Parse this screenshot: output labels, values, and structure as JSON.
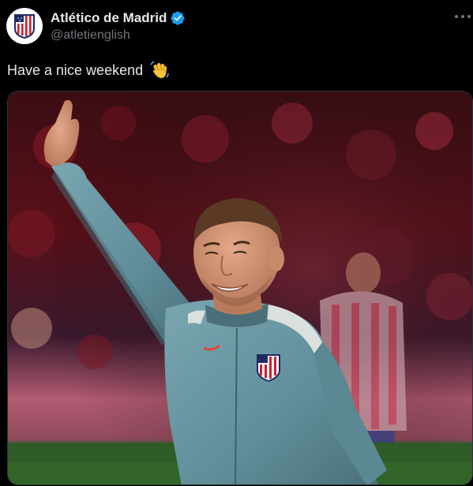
{
  "account": {
    "display_name": "Atlético de Madrid",
    "handle": "@atletienglish",
    "verified": true,
    "avatar_icon": "atletico-crest-icon"
  },
  "tweet": {
    "text": "Have a nice weekend",
    "emoji_icon": "waving-hand-icon"
  },
  "media": {
    "description_icon": "player-waving-photo",
    "kit_colors": {
      "shirt": "#6e98a3",
      "shirt_dark": "#4a6f79",
      "stripe": "#d9e0de",
      "background_red": "#7d1620"
    }
  },
  "colors": {
    "background": "#000000",
    "text_primary": "#e7e9ea",
    "text_secondary": "#71767b",
    "verified_blue": "#1d9bf0"
  }
}
